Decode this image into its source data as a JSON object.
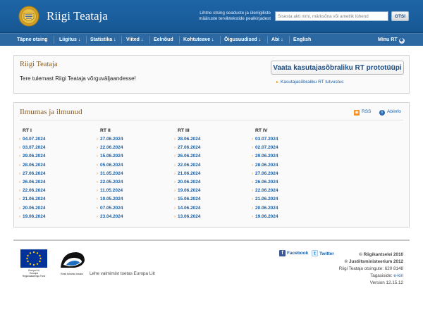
{
  "header": {
    "site_title": "Riigi Teataja",
    "search_hint_line1": "Lihtne otsing seaduste ja üleriigiliste",
    "search_hint_line2": "määruste terviktekstide pealkirjadest",
    "search_placeholder": "Sisesta akti nimi, märksõna või ametlik lühend",
    "search_button": "OTSI"
  },
  "nav": {
    "items": [
      "Täpne otsing",
      "Liigitus ↓",
      "Statistika ↓",
      "Viited ↓",
      "Eelnõud",
      "Kohtuteave ↓",
      "Õigusuudised ↓",
      "Abi ↓",
      "English"
    ],
    "minu_rt": "Minu RT"
  },
  "welcome_panel": {
    "title": "Riigi Teataja",
    "message": "Tere tulemast Riigi Teataja võrguväljaandesse!",
    "prototype_button": "Vaata kasutajasõbraliku RT prototüüpi",
    "prototype_link": "Kasutajasõbraliku RT tutvustus"
  },
  "issues_panel": {
    "title": "Ilmumas ja ilmunud",
    "rss_label": "RSS",
    "info_label": "Abiinfo",
    "columns": [
      {
        "header": "RT I",
        "dates": [
          "04.07.2024",
          "03.07.2024",
          "29.06.2024",
          "28.06.2024",
          "27.06.2024",
          "26.06.2024",
          "22.06.2024",
          "21.06.2024",
          "20.06.2024",
          "19.06.2024"
        ]
      },
      {
        "header": "RT II",
        "dates": [
          "27.06.2024",
          "22.06.2024",
          "15.06.2024",
          "05.06.2024",
          "31.05.2024",
          "22.05.2024",
          "11.05.2024",
          "10.05.2024",
          "07.05.2024",
          "23.04.2024"
        ]
      },
      {
        "header": "RT III",
        "dates": [
          "28.06.2024",
          "27.06.2024",
          "26.06.2024",
          "22.06.2024",
          "21.06.2024",
          "20.06.2024",
          "19.06.2024",
          "15.06.2024",
          "14.06.2024",
          "13.06.2024"
        ]
      },
      {
        "header": "RT IV",
        "dates": [
          "03.07.2024",
          "02.07.2024",
          "29.06.2024",
          "28.06.2024",
          "27.06.2024",
          "26.06.2024",
          "22.06.2024",
          "21.06.2024",
          "20.06.2024",
          "19.06.2024"
        ]
      }
    ]
  },
  "footer": {
    "eu_logo_text_line1": "Europa Liit",
    "eu_logo_text_line2": "Euroopa",
    "eu_logo_text_line3": "Regionaalarengu Fond",
    "est_logo_text": "Eesti tuleviku heaks",
    "eu_caption": "Lehe valmimist toetas Europa Liit",
    "facebook": "Facebook",
    "twitter": "Twitter",
    "copyright1": "© Riigikantselei 2010",
    "copyright2": "© Justiitsministeerium 2012",
    "contact_phone": "Riigi Teataja otsingute: 620 8148",
    "feedback_label": "Tagasiside:",
    "feedback_link": "e-kiri",
    "version": "Version 12.15.12"
  },
  "colors": {
    "header_blue": "#1d65a6",
    "nav_blue": "#2c68a2",
    "link_blue": "#1b5fa5",
    "panel_title_brown": "#8a5a1c",
    "bullet_orange": "#e48a1a"
  },
  "icons": {
    "logo": "coat-of-arms-icon",
    "minu_rt": "gear-icon",
    "rss": "rss-icon",
    "info": "info-icon",
    "facebook": "facebook-icon",
    "twitter": "twitter-icon"
  }
}
